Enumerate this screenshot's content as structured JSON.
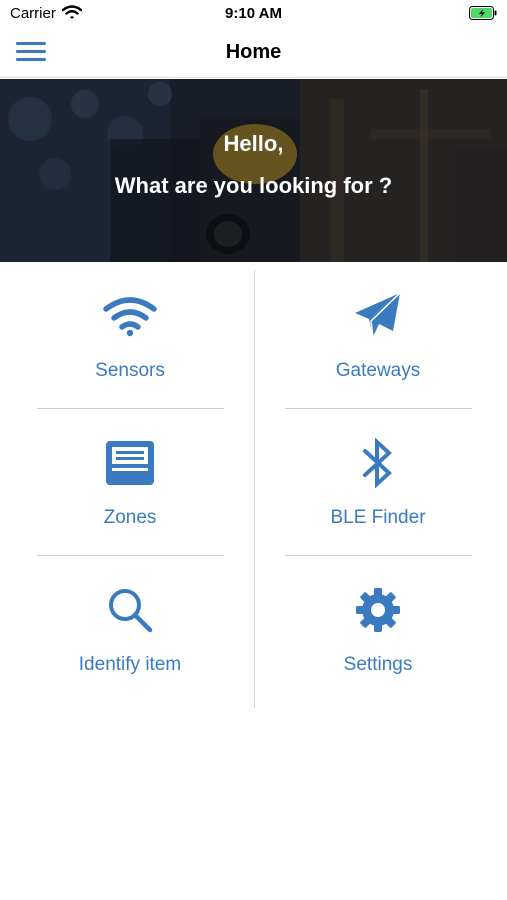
{
  "status_bar": {
    "carrier": "Carrier",
    "time": "9:10 AM"
  },
  "nav": {
    "title": "Home"
  },
  "hero": {
    "greeting": "Hello,",
    "question": "What are you looking for ?"
  },
  "colors": {
    "accent": "#3a7bbf",
    "battery": "#4cd964"
  },
  "menu": [
    {
      "label": "Sensors",
      "icon": "wifi-icon"
    },
    {
      "label": "Gateways",
      "icon": "paper-plane-icon"
    },
    {
      "label": "Zones",
      "icon": "inbox-tray-icon"
    },
    {
      "label": "BLE Finder",
      "icon": "bluetooth-icon"
    },
    {
      "label": "Identify item",
      "icon": "search-icon"
    },
    {
      "label": "Settings",
      "icon": "gear-icon"
    }
  ]
}
